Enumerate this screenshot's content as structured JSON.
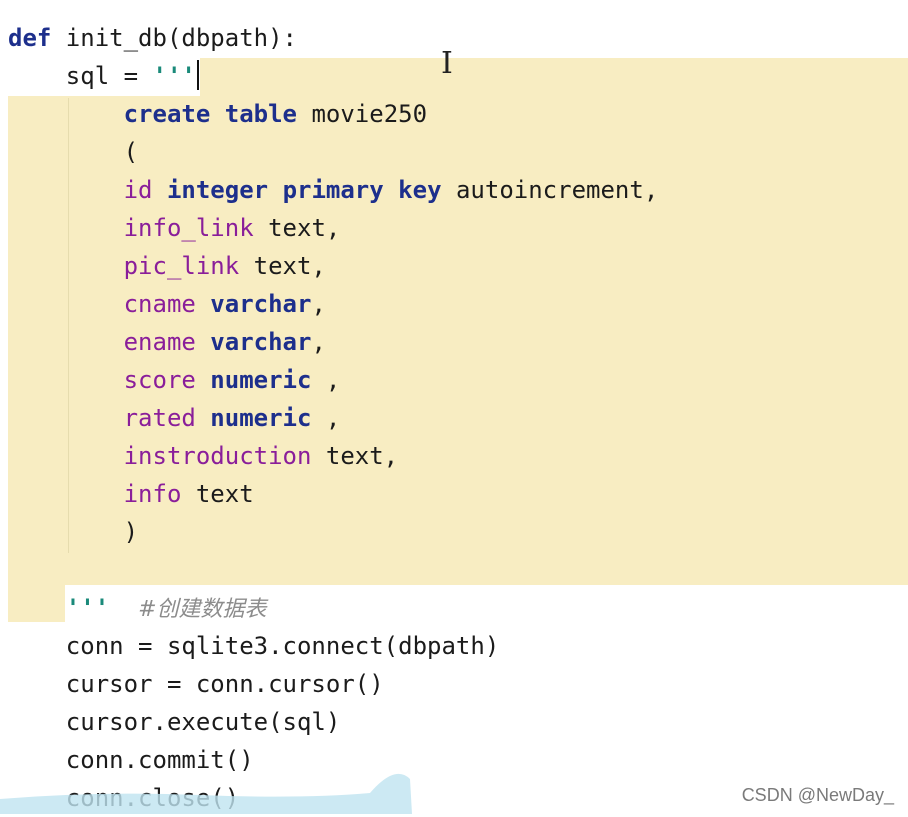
{
  "editor": {
    "lines": [
      [
        [
          "def",
          "kw"
        ],
        [
          " init_db(dbpath):",
          ""
        ]
      ],
      [
        [
          "    sql = ",
          ""
        ],
        [
          "'''",
          "str"
        ]
      ],
      [
        [
          "        ",
          ""
        ],
        [
          "create",
          "kw"
        ],
        [
          " ",
          ""
        ],
        [
          "table",
          "kw"
        ],
        [
          " movie250",
          ""
        ]
      ],
      [
        [
          "        (",
          ""
        ]
      ],
      [
        [
          "        ",
          ""
        ],
        [
          "id",
          "fld"
        ],
        [
          " ",
          ""
        ],
        [
          "integer",
          "kw"
        ],
        [
          " ",
          ""
        ],
        [
          "primary",
          "kw"
        ],
        [
          " ",
          ""
        ],
        [
          "key",
          "kw"
        ],
        [
          " autoincrement,",
          ""
        ]
      ],
      [
        [
          "        ",
          ""
        ],
        [
          "info_link",
          "fld"
        ],
        [
          " text,",
          ""
        ]
      ],
      [
        [
          "        ",
          ""
        ],
        [
          "pic_link",
          "fld"
        ],
        [
          " text,",
          ""
        ]
      ],
      [
        [
          "        ",
          ""
        ],
        [
          "cname",
          "fld"
        ],
        [
          " ",
          ""
        ],
        [
          "varchar",
          "kw"
        ],
        [
          ",",
          ""
        ]
      ],
      [
        [
          "        ",
          ""
        ],
        [
          "ename",
          "fld"
        ],
        [
          " ",
          ""
        ],
        [
          "varchar",
          "kw"
        ],
        [
          ",",
          ""
        ]
      ],
      [
        [
          "        ",
          ""
        ],
        [
          "score",
          "fld"
        ],
        [
          " ",
          ""
        ],
        [
          "numeric",
          "kw"
        ],
        [
          " ,",
          ""
        ]
      ],
      [
        [
          "        ",
          ""
        ],
        [
          "rated",
          "fld"
        ],
        [
          " ",
          ""
        ],
        [
          "numeric",
          "kw"
        ],
        [
          " ,",
          ""
        ]
      ],
      [
        [
          "        ",
          ""
        ],
        [
          "instroduction",
          "fld"
        ],
        [
          " text,",
          ""
        ]
      ],
      [
        [
          "        ",
          ""
        ],
        [
          "info",
          "fld"
        ],
        [
          " text",
          ""
        ]
      ],
      [
        [
          "        )",
          ""
        ]
      ],
      [
        [
          "",
          ""
        ]
      ],
      [
        [
          "    ",
          ""
        ],
        [
          "'''",
          "str"
        ],
        [
          "  ",
          ""
        ],
        [
          "#创建数据表",
          "cmt"
        ]
      ],
      [
        [
          "    conn = sqlite3.connect(dbpath)",
          ""
        ]
      ],
      [
        [
          "    cursor = conn.cursor()",
          ""
        ]
      ],
      [
        [
          "    cursor.execute(sql)",
          ""
        ]
      ],
      [
        [
          "    conn.commit()",
          ""
        ]
      ],
      [
        [
          "    conn.close()",
          ""
        ]
      ]
    ],
    "colors": {
      "highlight": "#f8edc2",
      "keyword": "#1d2f8c",
      "field": "#8a1e9a",
      "string": "#1a8a7a"
    }
  },
  "watermark": "CSDN @NewDay_"
}
